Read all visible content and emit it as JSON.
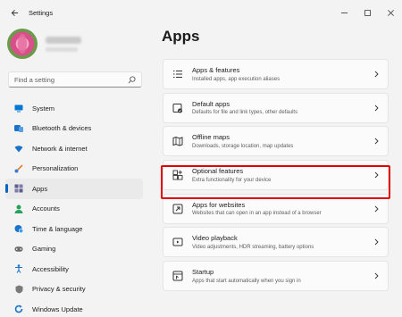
{
  "window": {
    "title": "Settings",
    "controls": [
      "minimize-icon",
      "maximize-icon",
      "close-icon"
    ]
  },
  "search": {
    "placeholder": "Find a setting"
  },
  "sidebar": {
    "items": [
      {
        "label": "System",
        "icon": "monitor-icon",
        "color": "#0078d4"
      },
      {
        "label": "Bluetooth & devices",
        "icon": "bluetooth-icon",
        "color": "#1a73c8"
      },
      {
        "label": "Network & internet",
        "icon": "wifi-icon",
        "color": "#1a73c8"
      },
      {
        "label": "Personalization",
        "icon": "brush-icon",
        "color": "#e0802c"
      },
      {
        "label": "Apps",
        "icon": "apps-icon",
        "color": "#5b5b8c",
        "active": true
      },
      {
        "label": "Accounts",
        "icon": "person-icon",
        "color": "#2aa15a"
      },
      {
        "label": "Time & language",
        "icon": "globe-clock-icon",
        "color": "#1a73c8"
      },
      {
        "label": "Gaming",
        "icon": "gamepad-icon",
        "color": "#6a6a6a"
      },
      {
        "label": "Accessibility",
        "icon": "accessibility-icon",
        "color": "#1a73c8"
      },
      {
        "label": "Privacy & security",
        "icon": "shield-icon",
        "color": "#7a7a7a"
      },
      {
        "label": "Windows Update",
        "icon": "update-icon",
        "color": "#1a73c8"
      }
    ]
  },
  "main": {
    "title": "Apps",
    "cards": [
      {
        "title": "Apps & features",
        "desc": "Installed apps, app execution aliases",
        "icon": "list-icon"
      },
      {
        "title": "Default apps",
        "desc": "Defaults for file and link types, other defaults",
        "icon": "default-apps-icon"
      },
      {
        "title": "Offline maps",
        "desc": "Downloads, storage location, map updates",
        "icon": "map-icon"
      },
      {
        "title": "Optional features",
        "desc": "Extra functionality for your device",
        "icon": "optional-features-icon",
        "highlighted": true
      },
      {
        "title": "Apps for websites",
        "desc": "Websites that can open in an app instead of a browser",
        "icon": "web-link-icon"
      },
      {
        "title": "Video playback",
        "desc": "Video adjustments, HDR streaming, battery options",
        "icon": "video-icon"
      },
      {
        "title": "Startup",
        "desc": "Apps that start automatically when you sign in",
        "icon": "startup-icon"
      }
    ]
  },
  "colors": {
    "accent": "#0067c0",
    "highlight": "#e00000",
    "background": "#f3f3f3",
    "card": "#fbfbfb"
  }
}
